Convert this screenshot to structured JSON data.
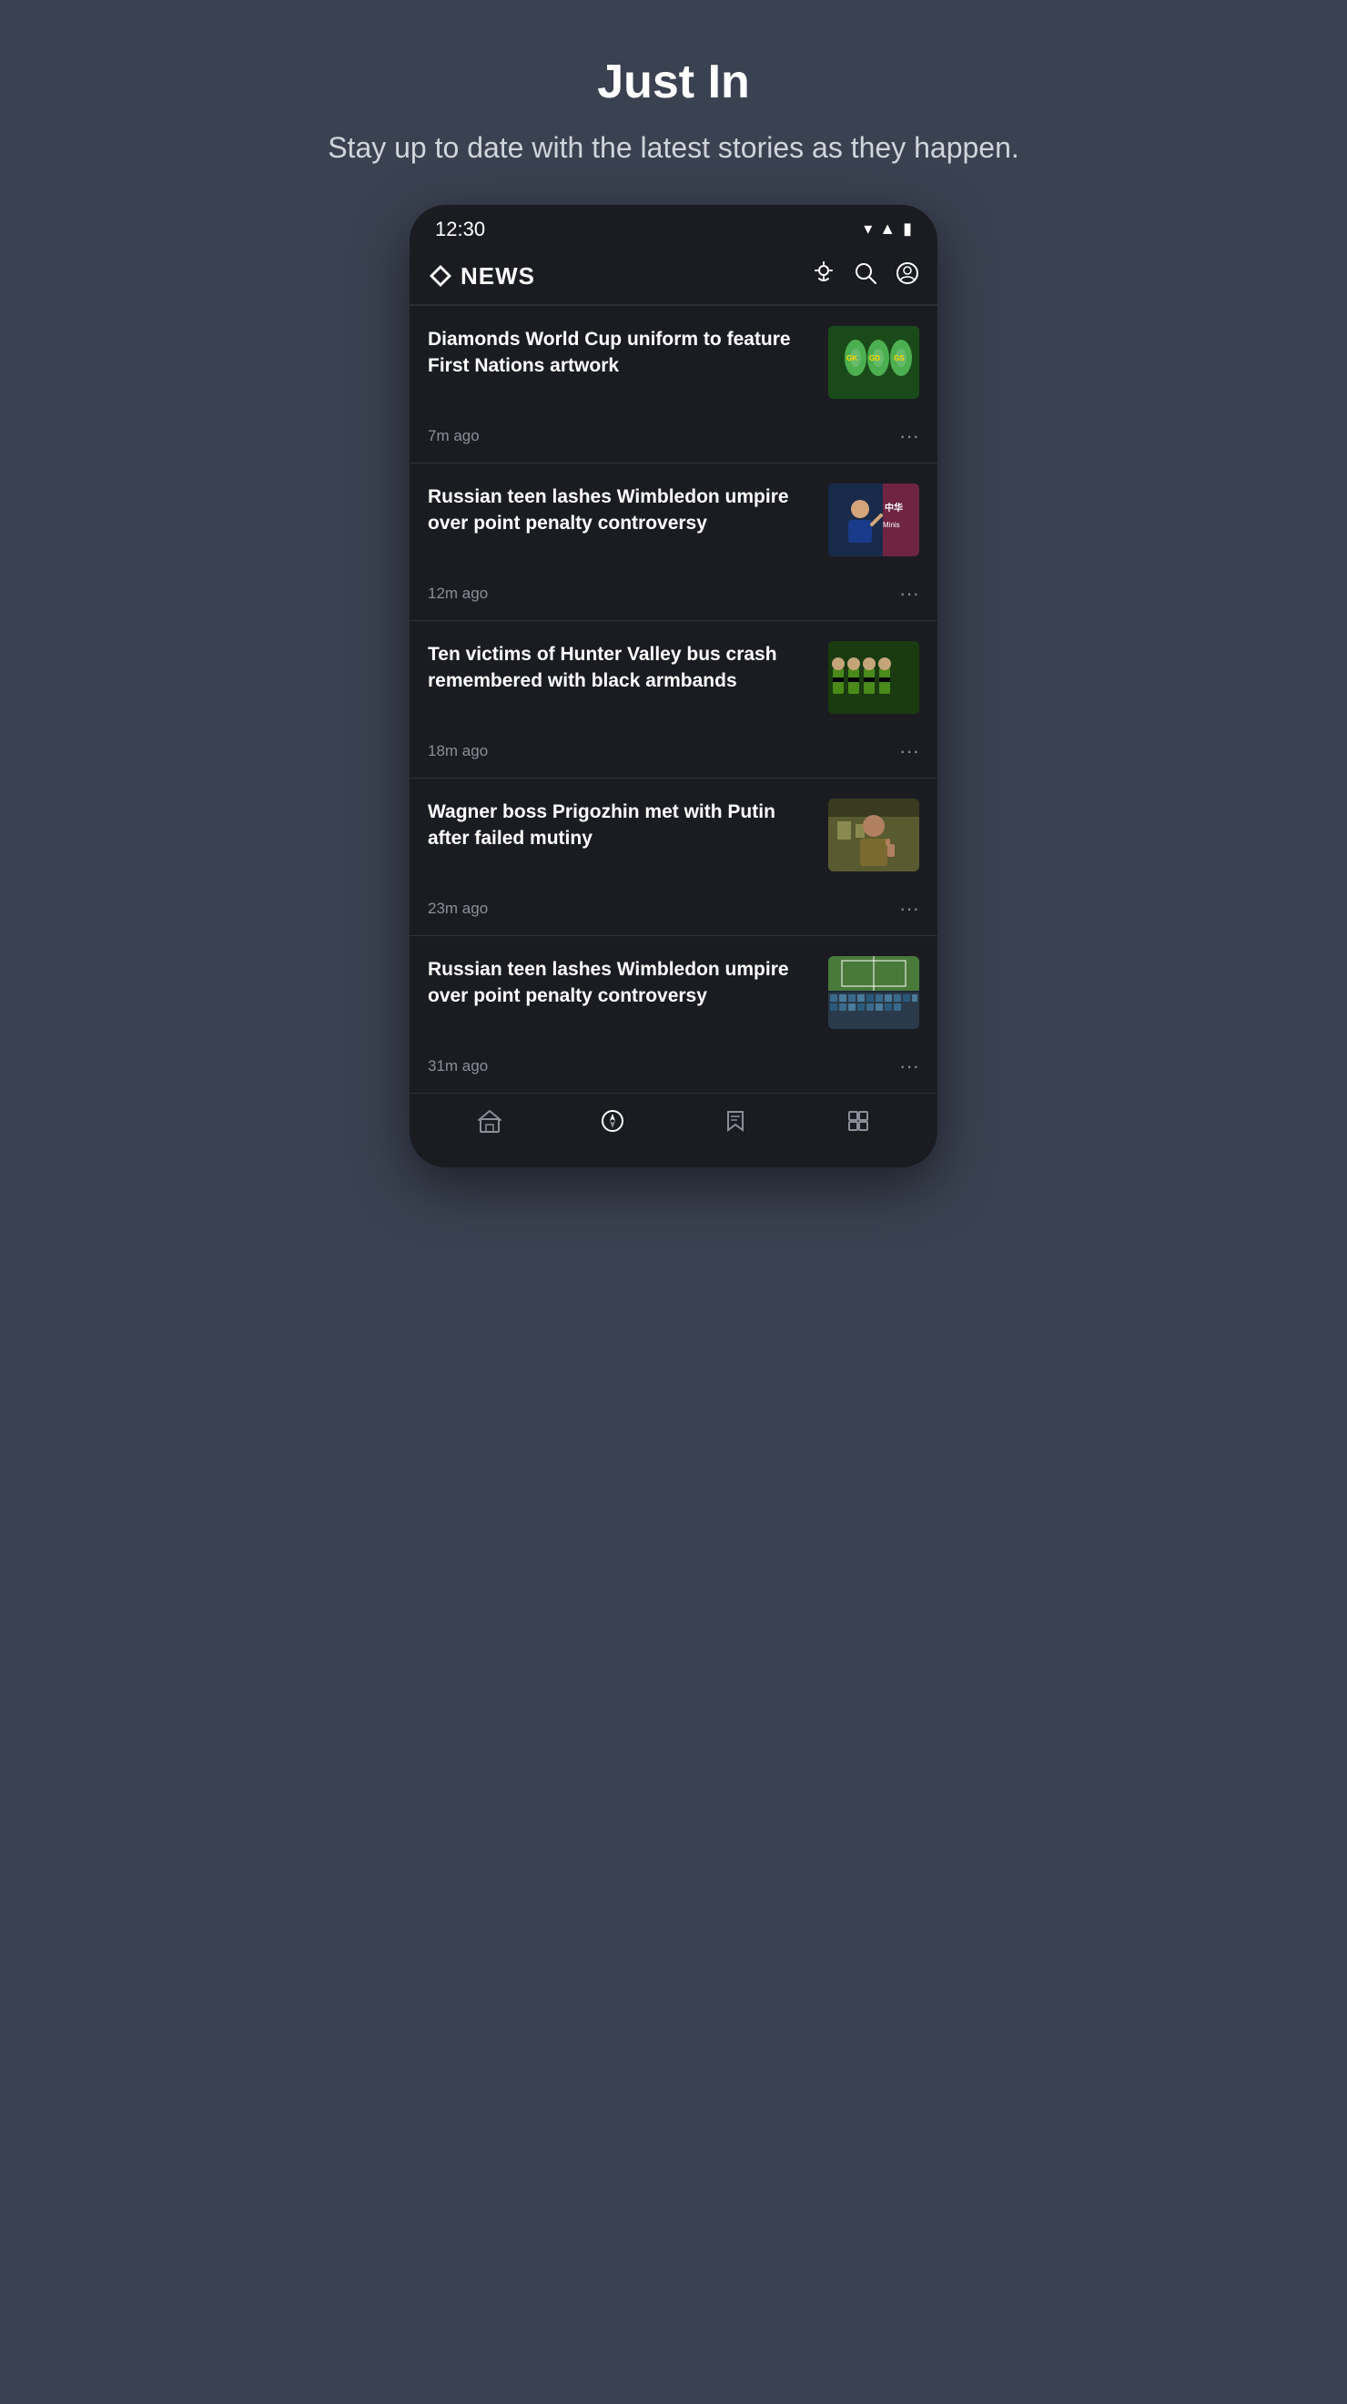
{
  "page": {
    "title": "Just In",
    "subtitle": "Stay up to date with the latest stories as they happen."
  },
  "statusBar": {
    "time": "12:30",
    "icons": [
      "wifi",
      "signal",
      "battery"
    ]
  },
  "appHeader": {
    "logo": "ABC",
    "newsLabel": "NEWS",
    "actions": [
      "weather",
      "search",
      "profile"
    ]
  },
  "newsItems": [
    {
      "id": 1,
      "title": "Diamonds World Cup uniform to feature First Nations artwork",
      "timestamp": "7m ago",
      "thumbnailType": "netball"
    },
    {
      "id": 2,
      "title": "Russian teen lashes Wimbledon umpire over point penalty controversy",
      "timestamp": "12m ago",
      "thumbnailType": "press"
    },
    {
      "id": 3,
      "title": "Ten victims of Hunter Valley bus crash remembered with black armbands",
      "timestamp": "18m ago",
      "thumbnailType": "football"
    },
    {
      "id": 4,
      "title": "Wagner boss Prigozhin met with Putin after failed mutiny",
      "timestamp": "23m ago",
      "thumbnailType": "military"
    },
    {
      "id": 5,
      "title": "Russian teen lashes Wimbledon umpire over point penalty controversy",
      "timestamp": "31m ago",
      "thumbnailType": "crowd"
    }
  ],
  "bottomNav": [
    {
      "id": "home",
      "label": "Home",
      "icon": "home",
      "active": false
    },
    {
      "id": "just-in",
      "label": "Just In",
      "icon": "compass",
      "active": true
    },
    {
      "id": "saved",
      "label": "Saved",
      "icon": "bookmark",
      "active": false
    },
    {
      "id": "more",
      "label": "More",
      "icon": "grid",
      "active": false
    }
  ]
}
